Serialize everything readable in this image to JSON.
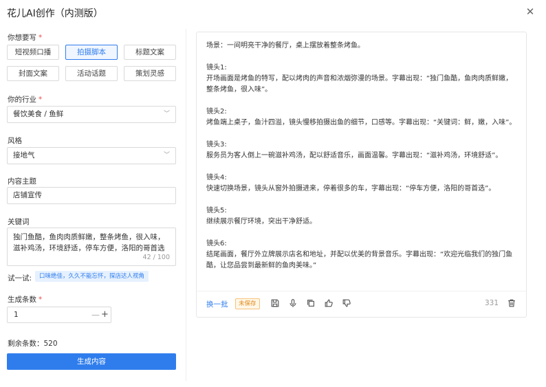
{
  "window": {
    "title": "花儿AI创作（内测版）"
  },
  "form": {
    "want_label": "你想要写",
    "content_types": [
      {
        "label": "短视频口播",
        "active": false
      },
      {
        "label": "拍摄脚本",
        "active": true
      },
      {
        "label": "标题文案",
        "active": false
      },
      {
        "label": "封面文案",
        "active": false
      },
      {
        "label": "活动话题",
        "active": false
      },
      {
        "label": "策划灵感",
        "active": false
      }
    ],
    "industry_label": "你的行业",
    "industry_value": "餐饮美食 / 鱼鲜",
    "style_label": "风格",
    "style_value": "接地气",
    "topic_label": "内容主题",
    "topic_value": "店铺宣传",
    "keywords_label": "关键词",
    "keywords_value": "独门鱼酷，鱼肉肉质鲜嫩，整条烤鱼，很入味，滋补鸡汤，环境舒适，停车方便，洛阳的哥首选",
    "keywords_counter": "42 / 100",
    "try_label": "试一试:",
    "try_suggestion": "口味绝佳，久久不能忘怀，探店达人视角",
    "count_label": "生成条数",
    "count_value": "1",
    "remaining_text": "剩余条数：520",
    "generate_label": "生成内容"
  },
  "result": {
    "paragraphs": [
      {
        "head": "",
        "text": "场景：一间明亮干净的餐厅，桌上摆放着整条烤鱼。"
      },
      {
        "head": "镜头1:",
        "text": "开场画面是烤鱼的特写，配以烤肉的声音和浓烟弥漫的场景。字幕出现：“独门鱼酷，鱼肉肉质鲜嫩，整条烤鱼，很入味”。"
      },
      {
        "head": "镜头2:",
        "text": "烤鱼端上桌子，鱼汁四溢，镜头慢移拍摄出鱼的细节，口感等。字幕出现：“关键词：鲜，嫩，入味”。"
      },
      {
        "head": "镜头3:",
        "text": "服务员为客人倒上一碗滋补鸡汤，配以舒适音乐，画面温馨。字幕出现：“滋补鸡汤，环境舒适”。"
      },
      {
        "head": "镜头4:",
        "text": "快速切换场景，镜头从窗外拍摄进来，停着很多的车，字幕出现：“停车方便，洛阳的哥首选”。"
      },
      {
        "head": "镜头5:",
        "text": "继续展示餐厅环境，突出干净舒适。"
      },
      {
        "head": "镜头6:",
        "text": "结尾画面，餐厅外立牌展示店名和地址，并配以优美的背景音乐。字幕出现：“欢迎光临我们的独门鱼酷，让您品尝到最新鲜的鱼肉美味。”"
      }
    ],
    "regen_label": "换一批",
    "unsaved_badge": "未保存",
    "word_count": "331"
  },
  "icons": {
    "close": "close-icon",
    "arrow": "chevron-down-icon",
    "save": "save-icon",
    "voice": "microphone-icon",
    "copy": "copy-icon",
    "like": "thumb-up-icon",
    "dislike": "thumb-down-icon",
    "delete": "trash-icon"
  },
  "colors": {
    "accent": "#2f7ded",
    "required": "#f04a4a",
    "unsaved": "#e08a1c"
  }
}
